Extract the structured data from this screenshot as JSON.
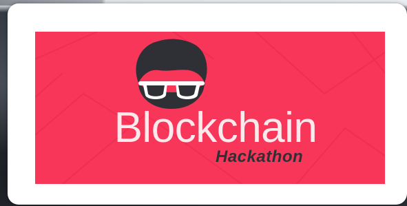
{
  "colors": {
    "banner_bg": "#f7365a",
    "title_text": "#fbe9ec",
    "subtitle_text": "#2f3035",
    "hair": "#2f3035",
    "glasses": "#ffffff"
  },
  "banner": {
    "logo_icon": "hackathon-mascot-icon",
    "title": "Blockchain",
    "subtitle": "Hackathon"
  }
}
